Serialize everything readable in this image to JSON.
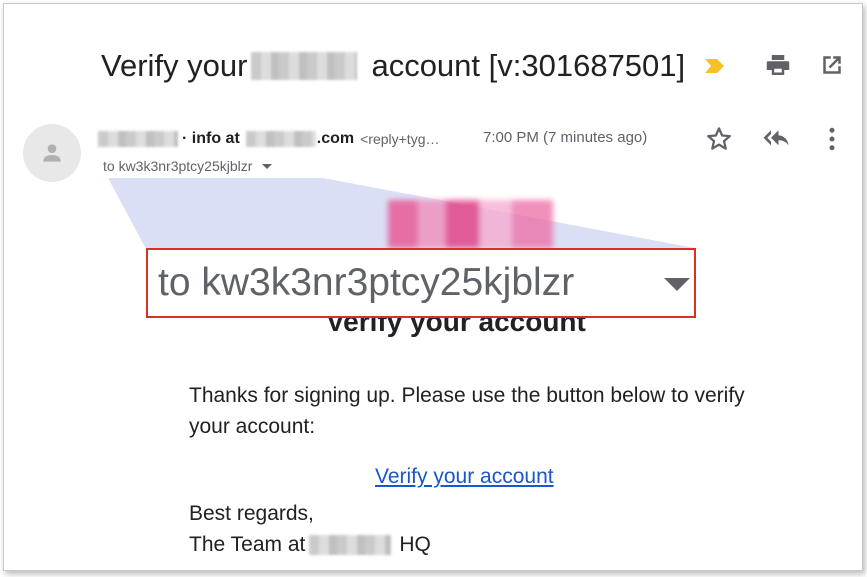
{
  "email": {
    "subject_prefix": "Verify your",
    "subject_suffix": "account [v:301687501]",
    "sender": {
      "name_middle": "· info at",
      "domain_suffix": ".com",
      "reply_to": "<reply+tyg…",
      "time": "7:00 PM (7 minutes ago)"
    },
    "to_line": "to kw3k3nr3ptcy25kjblzr",
    "zoom_to_line": "to kw3k3nr3ptcy25kjblzr"
  },
  "body": {
    "heading": "Verify your account",
    "paragraph": "Thanks for signing up. Please use the button below to verify your account:",
    "link_label": "Verify your account",
    "signoff": "Best regards,",
    "team_prefix": "The Team at",
    "team_suffix": "HQ"
  },
  "icons": {
    "important": "important-marker-icon",
    "print": "print-icon",
    "open_new_window": "open-in-new-window-icon",
    "star": "star-icon",
    "reply_all": "reply-all-icon",
    "more": "more-vert-icon",
    "avatar": "person-icon",
    "caret": "chevron-down-icon"
  },
  "colors": {
    "highlight_border": "#d93025",
    "important_marker": "#f6c026",
    "link": "#1a57c9",
    "wedge": "#d7dcf5"
  }
}
